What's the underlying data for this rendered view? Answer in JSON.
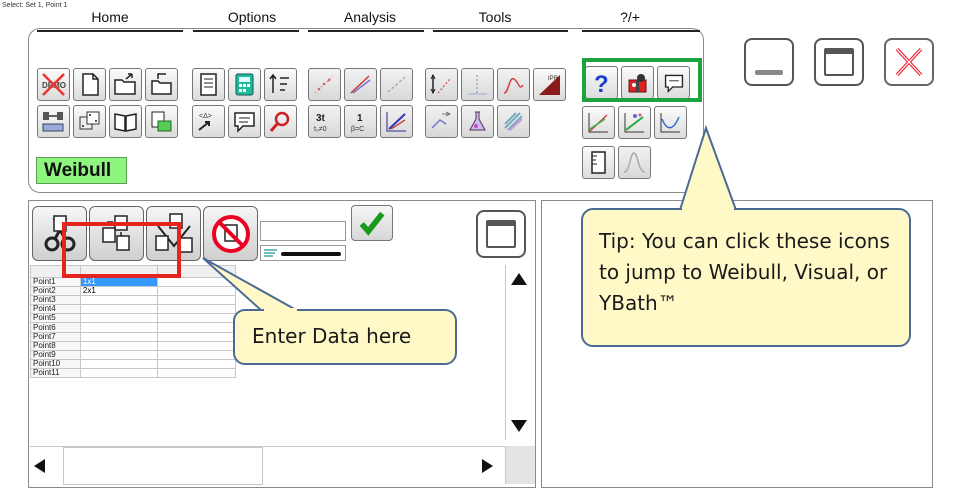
{
  "status_text": "Select: Set 1, Point 1",
  "menu": {
    "home": "Home",
    "options": "Options",
    "analysis": "Analysis",
    "tools": "Tools",
    "more": "?/+"
  },
  "distribution_label": "Weibull",
  "icons": {
    "demo": "DEMO",
    "text_3t": "3t",
    "text_1": "1",
    "text_beta": "β=C",
    "text_t0": "t₀≠0",
    "text_ipr": "IPR"
  },
  "grid": {
    "rows": [
      {
        "label": "Point1",
        "value": "1x1"
      },
      {
        "label": "Point2",
        "value": "2x1"
      },
      {
        "label": "Point3",
        "value": ""
      },
      {
        "label": "Point4",
        "value": ""
      },
      {
        "label": "Point5",
        "value": ""
      },
      {
        "label": "Point6",
        "value": ""
      },
      {
        "label": "Point7",
        "value": ""
      },
      {
        "label": "Point8",
        "value": ""
      },
      {
        "label": "Point9",
        "value": ""
      },
      {
        "label": "Point10",
        "value": ""
      },
      {
        "label": "Point11",
        "value": ""
      }
    ]
  },
  "callouts": {
    "enter_data": "Enter Data here",
    "tip": "Tip: You can click these icons to jump to Weibull, Visual, or YBath™"
  },
  "colors": {
    "highlight_green": "#1da43f",
    "highlight_red": "#e3241f",
    "callout_fill": "#fff9c8",
    "callout_border": "#4b6a94",
    "weibull_tag": "#8ef57f",
    "selection": "#3399ff"
  }
}
